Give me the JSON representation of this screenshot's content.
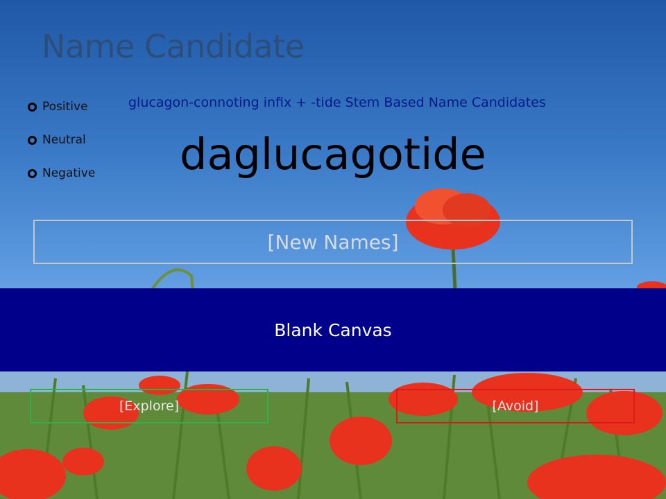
{
  "title": "Name Candidate",
  "sentiment_options": [
    {
      "label": "Positive"
    },
    {
      "label": "Neutral"
    },
    {
      "label": "Negative"
    }
  ],
  "subtitle": "glucagon-connoting infix + -tide Stem Based Name Candidates",
  "candidate_name": "daglucagotide",
  "new_names_label": "[New Names]",
  "blank_canvas_label": "Blank Canvas",
  "explore_label": "[Explore]",
  "avoid_label": "[Avoid]",
  "colors": {
    "title": "#2c4e7a",
    "subtitle": "#001a8c",
    "canvas_band": "#00008b",
    "explore_border": "#2bb34a",
    "avoid_border": "#e01818"
  }
}
